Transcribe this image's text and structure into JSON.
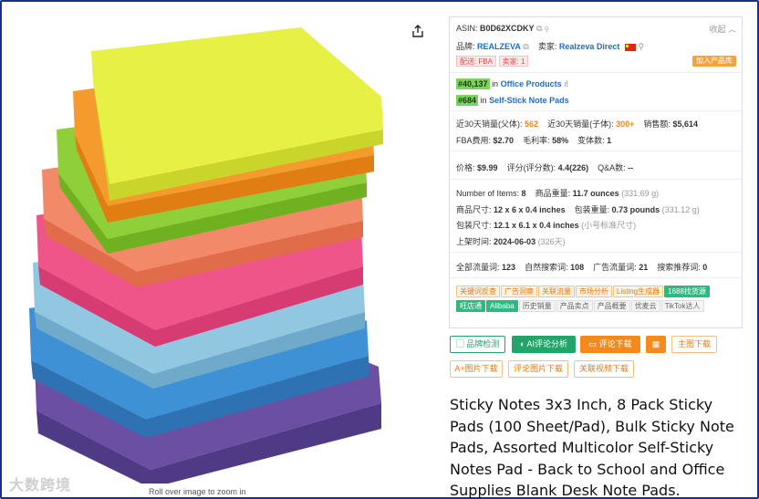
{
  "image": {
    "zoom_hint": "Roll over image to zoom in",
    "watermark": "大数跨境"
  },
  "share_icon": "share-icon",
  "panel": {
    "asin_label": "ASIN:",
    "asin": "B0D62XCDKY",
    "collapse": "收起",
    "brand_label": "品牌:",
    "brand": "REALZEVA",
    "seller_label": "卖家:",
    "seller": "Realzeva Direct",
    "ship_tag": "配送: FBA",
    "seller_tag": "卖家: 1",
    "add_library": "加入产品库",
    "rank1": "#40,137",
    "rank1_in": "in",
    "rank1_cat": "Office Products",
    "rank2": "#684",
    "rank2_in": "in",
    "rank2_cat": "Self-Stick Note Pads",
    "sales_parent_label": "近30天销量(父体):",
    "sales_parent": "562",
    "sales_child_label": "近30天销量(子体):",
    "sales_child": "300+",
    "revenue_label": "销售额:",
    "revenue": "$5,614",
    "fba_label": "FBA费用:",
    "fba": "$2.70",
    "margin_label": "毛利率:",
    "margin": "58%",
    "variants_label": "变体数:",
    "variants": "1",
    "price_label": "价格:",
    "price": "$9.99",
    "rating_label": "评分(评分数):",
    "rating": "4.4(226)",
    "qa_label": "Q&A数:",
    "qa": "--",
    "items_label": "Number of Items:",
    "items": "8",
    "weight_label": "商品重量:",
    "weight": "11.7 ounces",
    "weight_g": "(331.69 g)",
    "dims_label": "商品尺寸:",
    "dims": "12 x 6 x 0.4 inches",
    "pkg_weight_label": "包装重量:",
    "pkg_weight": "0.73 pounds",
    "pkg_weight_g": "(331.12 g)",
    "pkg_dims_label": "包装尺寸:",
    "pkg_dims": "12.1 x 6.1 x 0.4 inches",
    "pkg_dims_note": "(小号标准尺寸)",
    "launch_label": "上架时间:",
    "launch": "2024-06-03",
    "launch_days": "(326天)",
    "all_kw_label": "全部流量词:",
    "all_kw": "123",
    "organic_label": "自然搜索词:",
    "organic": "108",
    "ad_label": "广告流量词:",
    "ad": "21",
    "rec_label": "搜索推荐词:",
    "rec": "0"
  },
  "tags": [
    {
      "label": "关键词反查",
      "style": "orange"
    },
    {
      "label": "广告洞察",
      "style": "orange"
    },
    {
      "label": "关联流量",
      "style": "orange"
    },
    {
      "label": "市场分析",
      "style": "orange"
    },
    {
      "label": "Listing生成器",
      "style": "orange"
    },
    {
      "label": "1688找货源",
      "style": "green"
    },
    {
      "label": "旺店通",
      "style": "green"
    },
    {
      "label": "Alibaba",
      "style": "green"
    },
    {
      "label": "历史销量",
      "style": "grey"
    },
    {
      "label": "产品卖点",
      "style": "grey"
    },
    {
      "label": "产品概要",
      "style": "grey"
    },
    {
      "label": "优麦云",
      "style": "grey"
    },
    {
      "label": "TikTok达人",
      "style": "grey"
    }
  ],
  "buttons": {
    "brand_check": "品牌检测",
    "ai_review": "AI评论分析",
    "review_download": "评论下载",
    "main_image_download": "主图下载",
    "aplus_download": "A+图片下载",
    "review_image_download": "评论图片下载",
    "related_video_download": "关联视频下载"
  },
  "title": "Sticky Notes 3x3 Inch, 8 Pack Sticky Pads (100 Sheet/Pad), Bulk Sticky Note Pads, Assorted Multicolor Self-Sticky Notes Pad - Back to School and Office Supplies Blank Desk Note Pads."
}
